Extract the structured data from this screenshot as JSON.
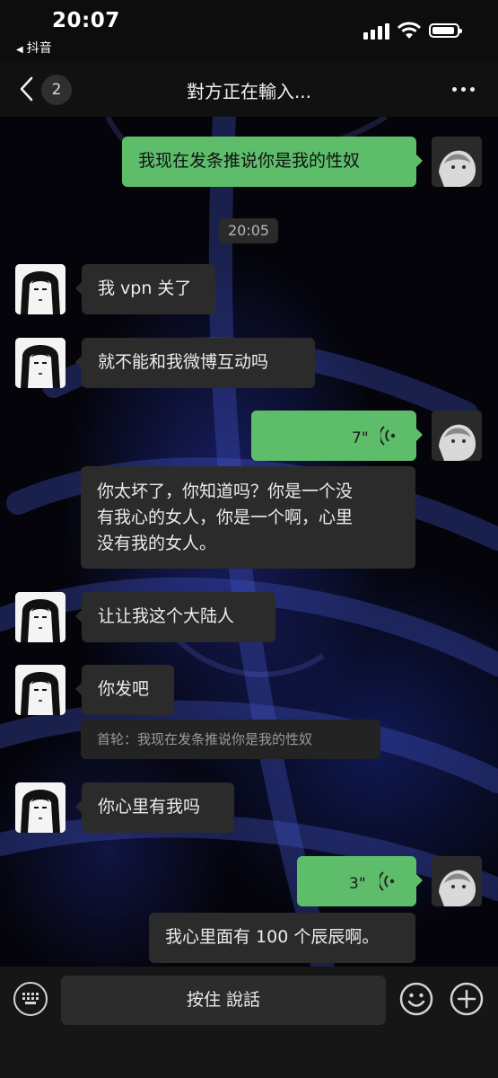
{
  "status_bar": {
    "time": "20:07",
    "back_app": "抖音"
  },
  "nav": {
    "unread_count": "2",
    "title": "對方正在輸入..."
  },
  "messages": [
    {
      "side": "right",
      "type": "text",
      "text": "我现在发条推说你是我的性奴"
    },
    {
      "type": "timestamp",
      "text": "20:05"
    },
    {
      "side": "left",
      "type": "text",
      "text": "我 vpn 关了"
    },
    {
      "side": "left",
      "type": "text",
      "text": "就不能和我微博互动吗"
    },
    {
      "side": "right",
      "type": "voice",
      "duration": "7\""
    },
    {
      "side": "left",
      "type": "text",
      "text_lines": [
        "你太坏了，你知道吗？你是一个没",
        "有我心的女人，你是一个啊，心里",
        "没有我的女人。"
      ]
    },
    {
      "side": "left",
      "type": "text",
      "text": "让让我这个大陆人"
    },
    {
      "side": "left",
      "type": "text",
      "text": "你发吧"
    },
    {
      "side": "left",
      "type": "quote",
      "text": "首轮：我现在发条推说你是我的性奴"
    },
    {
      "side": "left",
      "type": "text",
      "text": "你心里有我吗"
    },
    {
      "side": "right",
      "type": "voice",
      "duration": "3\""
    },
    {
      "side": "right",
      "type": "text",
      "text": "我心里面有 100 个辰辰啊。"
    }
  ],
  "input_bar": {
    "hold_to_talk": "按住 說話",
    "icons": [
      "keyboard-icon",
      "emoji-icon",
      "plus-icon"
    ]
  },
  "colors": {
    "outgoing_bubble": "#5ebd6b",
    "incoming_bubble": "#2b2b2b",
    "background": "#050508"
  }
}
